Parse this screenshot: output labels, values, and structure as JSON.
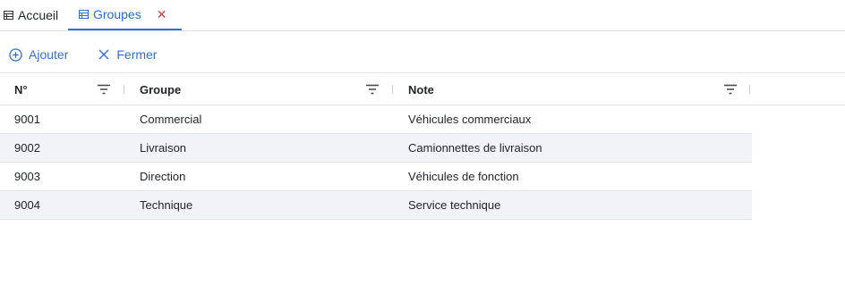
{
  "tabs": [
    {
      "label": "Accueil",
      "icon": "table-icon",
      "active": false
    },
    {
      "label": "Groupes",
      "icon": "table-icon",
      "active": true,
      "close_glyph": "✕"
    }
  ],
  "toolbar": {
    "add_label": "Ajouter",
    "close_label": "Fermer"
  },
  "grid": {
    "columns": [
      "N°",
      "Groupe",
      "Note"
    ],
    "rows": [
      {
        "num": "9001",
        "group": "Commercial",
        "note": "Véhicules commerciaux"
      },
      {
        "num": "9002",
        "group": "Livraison",
        "note": "Camionnettes de livraison"
      },
      {
        "num": "9003",
        "group": "Direction",
        "note": "Véhicules de fonction"
      },
      {
        "num": "9004",
        "group": "Technique",
        "note": "Service technique"
      }
    ]
  },
  "colors": {
    "accent": "#2f6fde",
    "close": "#e03a3a",
    "row_alt": "#f0f3f7"
  }
}
